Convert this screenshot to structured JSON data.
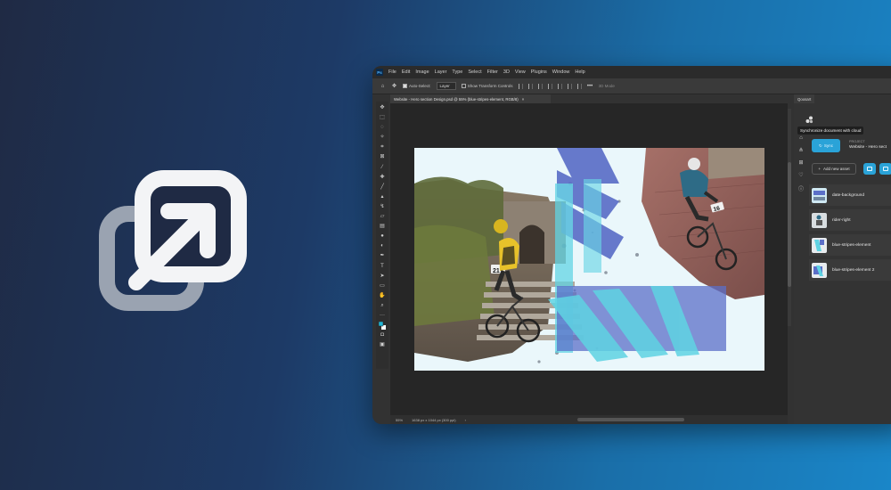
{
  "menu": [
    "File",
    "Edit",
    "Image",
    "Layer",
    "Type",
    "Select",
    "Filter",
    "3D",
    "View",
    "Plugins",
    "Window",
    "Help"
  ],
  "options_bar": {
    "auto_select_label": "Auto-Select:",
    "auto_select_value": "Layer",
    "transform_label": "Show Transform Controls",
    "mode_label": "3D Mode"
  },
  "document_tab": {
    "title": "Website - Hero section Design.psd @ 55% (blue-stripes-element, RGB/8)",
    "close": "×"
  },
  "status": {
    "zoom": "55%",
    "dimensions": "1638 px x 1044 px (300 ppi)"
  },
  "panel": {
    "tab_label": "Qoosart",
    "tooltip": "Synchronize document with cloud",
    "sync_label": "Sync",
    "project_label": "PROJECT",
    "project_name": "Website - Hero sect",
    "add_asset_label": "Add new asset",
    "assets": [
      {
        "name": "date-background"
      },
      {
        "name": "rider-right"
      },
      {
        "name": "blue-stripes-element"
      },
      {
        "name": "blue-stripes-element 2"
      }
    ]
  },
  "artboard": {
    "rider_left_number": "21",
    "rider_right_number": "16"
  },
  "colors": {
    "accent": "#2aa3d8",
    "stripe_blue": "#5b6fc8",
    "stripe_cyan": "#5fd3e3",
    "background_start": "#1f2a44",
    "background_end": "#1a86c8"
  }
}
